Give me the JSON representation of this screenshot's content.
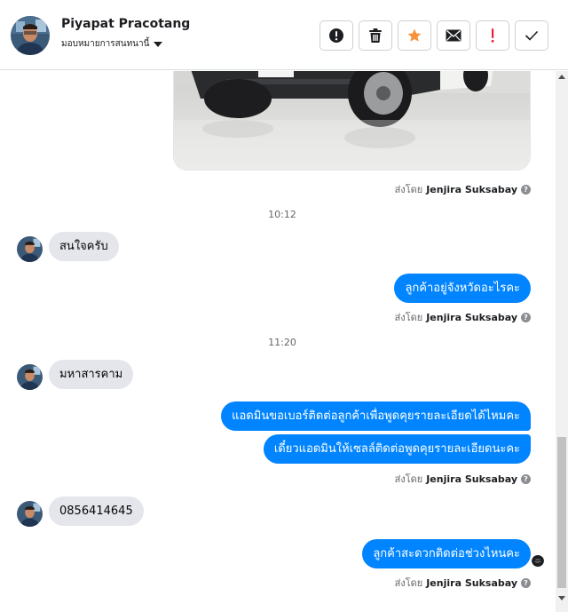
{
  "header": {
    "contact_name": "Piyapat Pracotang",
    "assign_label": "มอบหมายการสนทนานี้",
    "actions": [
      {
        "name": "spam-button",
        "icon": "alert-circle-icon"
      },
      {
        "name": "delete-button",
        "icon": "trash-icon"
      },
      {
        "name": "star-button",
        "icon": "star-icon"
      },
      {
        "name": "mark-unread-button",
        "icon": "envelope-icon"
      },
      {
        "name": "follow-up-button",
        "icon": "exclamation-icon"
      },
      {
        "name": "mark-done-button",
        "icon": "checkmark-icon"
      }
    ]
  },
  "messages": {
    "sent_by_prefix": "ส่งโดย",
    "sender_name": "Jenjira Suksabay",
    "help_symbol": "?",
    "time_1": "10:12",
    "time_2": "11:20",
    "in_1": "สนใจครับ",
    "out_1": "ลูกค้าอยู่จังหวัดอะไรคะ",
    "in_2": "มหาสารคาม",
    "out_2": "แอดมินขอเบอร์ติดต่อลูกค้าเพื่อพูดคุยรายละเอียดได้ไหมคะ",
    "out_3": "เดี๋ยวแอดมินให้เซลล์ติดต่อพูดคุยรายละเอียดนะคะ",
    "in_3": "0856414645",
    "out_4": "ลูกค้าสะดวกติดต่อช่วงไหนคะ"
  },
  "colors": {
    "outgoing_bubble": "#0084ff",
    "incoming_bubble": "#e4e6eb",
    "star": "#f7923a",
    "follow_up": "#e41e3f"
  }
}
